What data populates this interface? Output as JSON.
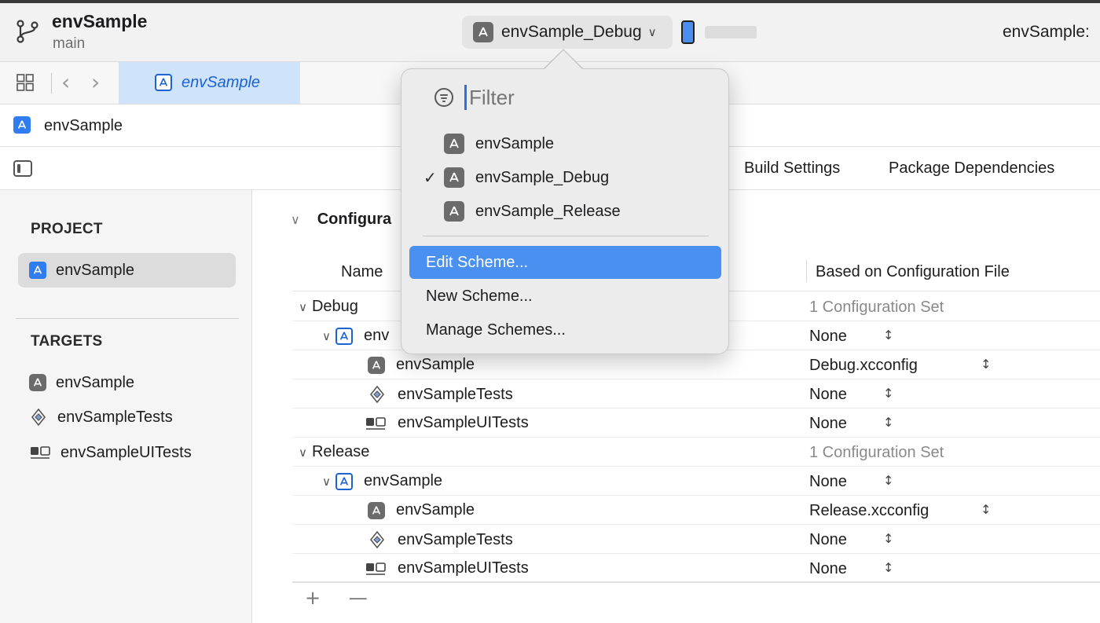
{
  "window": {
    "project_name": "envSample",
    "branch": "main",
    "scheme_selected": "envSample_Debug",
    "run_status": "envSample:"
  },
  "tabbar": {
    "active_tab": "envSample"
  },
  "jumpbar": {
    "crumb": "envSample"
  },
  "editor_tabs": [
    "Build Settings",
    "Package Dependencies"
  ],
  "sidebar": {
    "project_title": "PROJECT",
    "project_item": "envSample",
    "targets_title": "TARGETS",
    "targets": [
      {
        "label": "envSample",
        "icon": "app-icon"
      },
      {
        "label": "envSampleTests",
        "icon": "test-icon"
      },
      {
        "label": "envSampleUITests",
        "icon": "uitest-icon"
      }
    ]
  },
  "configurations": {
    "section_title": "Configura",
    "col_name": "Name",
    "col_config": "Based on Configuration File",
    "rows": [
      {
        "label": "Debug",
        "config": "1 Configuration Set"
      },
      {
        "label": "env",
        "config": "None"
      },
      {
        "label": "envSample",
        "config": "Debug.xcconfig"
      },
      {
        "label": "envSampleTests",
        "config": "None"
      },
      {
        "label": "envSampleUITests",
        "config": "None"
      },
      {
        "label": "Release",
        "config": "1 Configuration Set"
      },
      {
        "label": "envSample",
        "config": "None"
      },
      {
        "label": "envSample",
        "config": "Release.xcconfig"
      },
      {
        "label": "envSampleTests",
        "config": "None"
      },
      {
        "label": "envSampleUITests",
        "config": "None"
      }
    ],
    "add_label": "+",
    "remove_label": "—"
  },
  "scheme_menu": {
    "filter_placeholder": "Filter",
    "schemes": [
      {
        "label": "envSample",
        "checked": false
      },
      {
        "label": "envSample_Debug",
        "checked": true
      },
      {
        "label": "envSample_Release",
        "checked": false
      }
    ],
    "actions": [
      "Edit Scheme...",
      "New Scheme...",
      "Manage Schemes..."
    ],
    "checkmark": "✓"
  },
  "colors": {
    "accent": "#2f7df0",
    "highlight": "#4a90f0",
    "selected_tab": "#cfe3fb"
  }
}
